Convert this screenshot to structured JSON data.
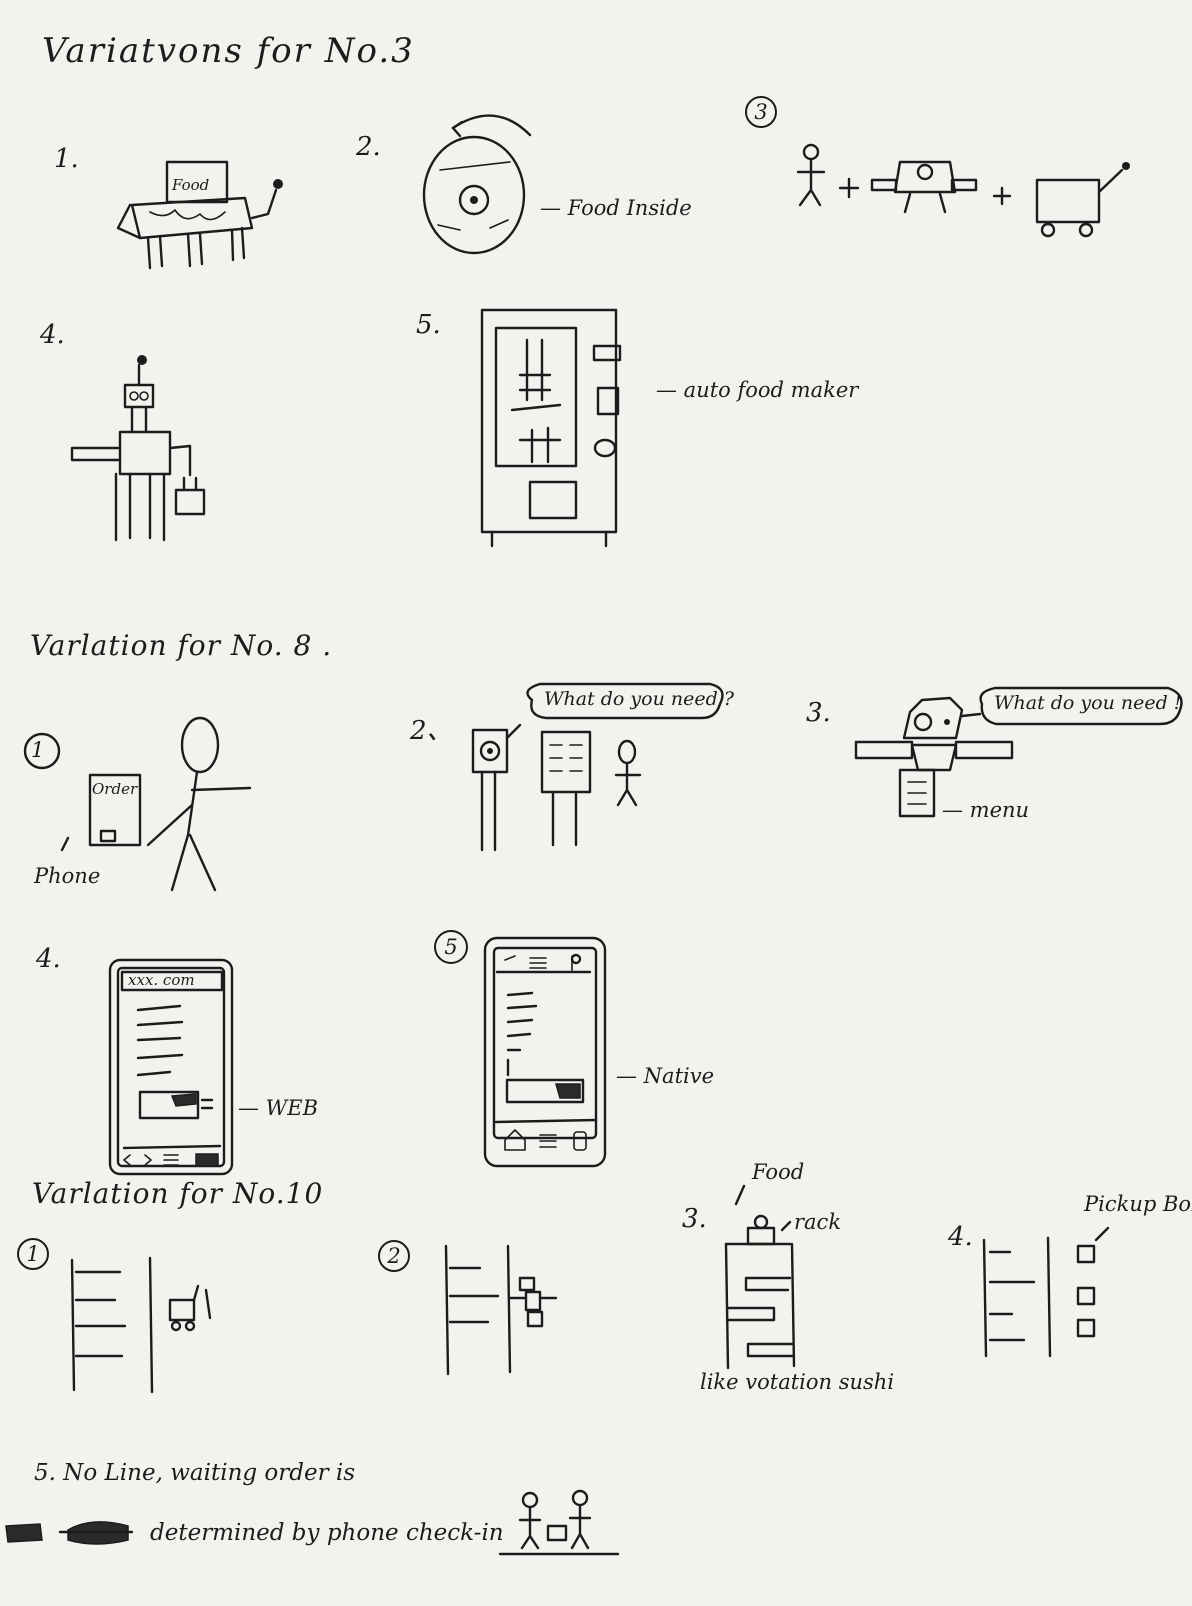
{
  "headings": {
    "no3": "Variatvons for No.3",
    "no8": "Varlation for   No. 8 .",
    "no10": "Varlation for   No.10"
  },
  "no3": {
    "n1": "1.",
    "n1_sign": "Food",
    "n2": "2.",
    "n2_label": "— Food Inside",
    "n3": "3",
    "n4": "4.",
    "n5": "5.",
    "n5_label": "— auto food maker"
  },
  "no8": {
    "n1": "1",
    "n1_screen": "Order",
    "n1_label": "Phone",
    "n2": "2、",
    "n2_bubble": "What do you need ?",
    "n3": "3.",
    "n3_bubble": "What do you need !",
    "n3_label": "— menu",
    "n4": "4.",
    "n4_url": "xxx. com",
    "n4_label": "— WEB",
    "n5": "5",
    "n5_label": "— Native"
  },
  "no10": {
    "n1": "1",
    "n2": "2",
    "n3": "3.",
    "n3_food": "Food",
    "n3_rack": "rack",
    "n3_caption": "like votation sushi",
    "n4": "4.",
    "n4_label": "Pickup Box",
    "n5_line1": "5.  No Line, waiting order is",
    "n5_line2": "determined by phone check-in"
  }
}
